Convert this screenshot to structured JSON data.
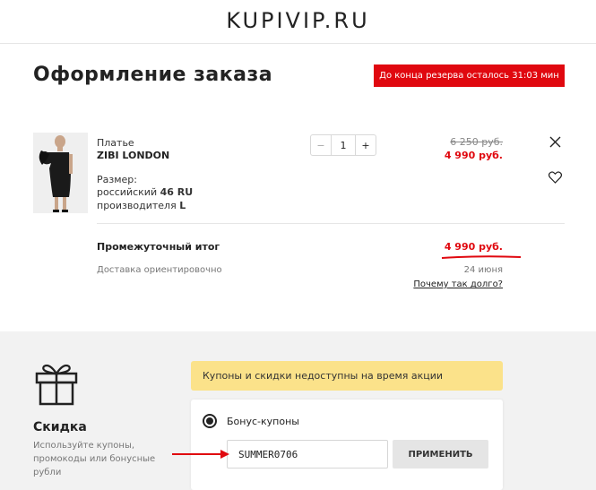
{
  "header": {
    "logo": "KUPIVIP.RU"
  },
  "page": {
    "title": "Оформление заказа"
  },
  "timer": {
    "text": "До конца резерва осталось 31:03 мин"
  },
  "item": {
    "type": "Платье",
    "brand": "ZIBI LONDON",
    "size_label": "Размер:",
    "size_ru_prefix": "российский",
    "size_ru": "46 RU",
    "size_mfr_prefix": "производителя",
    "size_mfr": "L",
    "qty_minus": "−",
    "qty_value": "1",
    "qty_plus": "+",
    "old_price": "6 250 руб.",
    "new_price": "4 990 руб."
  },
  "summary": {
    "subtotal_label": "Промежуточный итог",
    "subtotal_value": "4 990 руб.",
    "delivery_label": "Доставка ориентировочно",
    "delivery_date": "24 июня",
    "why_long": "Почему так долго?"
  },
  "discount": {
    "title": "Скидка",
    "description": "Используйте купоны, промокоды или бонусные рубли",
    "notice": "Купоны и скидки недоступны на время акции",
    "option_label": "Бонус-купоны",
    "coupon_value": "SUMMER0706",
    "apply_label": "ПРИМЕНИТЬ"
  },
  "colors": {
    "accent_red": "#e0080f",
    "notice_yellow": "#fbe28a",
    "bottom_bg": "#f2f2f2"
  },
  "icons": {
    "close": "close-icon",
    "heart": "heart-icon",
    "gift": "gift-icon",
    "arrow": "arrow-right-icon"
  }
}
